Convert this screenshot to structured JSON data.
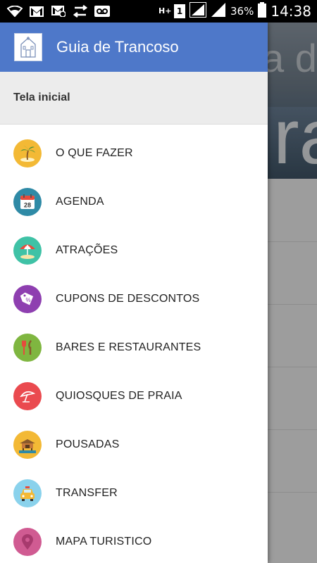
{
  "status_bar": {
    "battery": "36%",
    "time": "14:38",
    "network_label": "H+",
    "sim_label": "1",
    "icons": [
      "wifi-icon",
      "gmail-icon",
      "gmail-icon",
      "sync-icon",
      "voicemail-icon",
      "signal-icon",
      "signal-icon",
      "battery-icon"
    ]
  },
  "background": {
    "hero_text_top": "a d",
    "hero_text_big": "ra"
  },
  "drawer": {
    "title": "Guia de Trancoso",
    "home_label": "Tela inicial",
    "header_color": "#4e78c9",
    "items": [
      {
        "label": "O QUE FAZER",
        "icon": "palm-tree-icon",
        "color": "#f3b935"
      },
      {
        "label": "AGENDA",
        "icon": "calendar-icon",
        "color": "#2f8aa6",
        "icon_text": "28"
      },
      {
        "label": "ATRAÇÕES",
        "icon": "beach-umbrella-icon",
        "color": "#3fc2a6"
      },
      {
        "label": "CUPONS DE DESCONTOS",
        "icon": "coupon-tag-icon",
        "color": "#8e3fb0",
        "icon_text": "%"
      },
      {
        "label": "BARES E RESTAURANTES",
        "icon": "cutlery-icon",
        "color": "#7fb640"
      },
      {
        "label": "QUIOSQUES DE PRAIA",
        "icon": "umbrella-icon",
        "color": "#ea4a4f"
      },
      {
        "label": "POUSADAS",
        "icon": "bungalow-icon",
        "color": "#f3b935"
      },
      {
        "label": "TRANSFER",
        "icon": "taxi-icon",
        "color": "#8ad2ec"
      },
      {
        "label": "MAPA TURISTICO",
        "icon": "map-pin-icon",
        "color": "#d05b92"
      }
    ]
  }
}
